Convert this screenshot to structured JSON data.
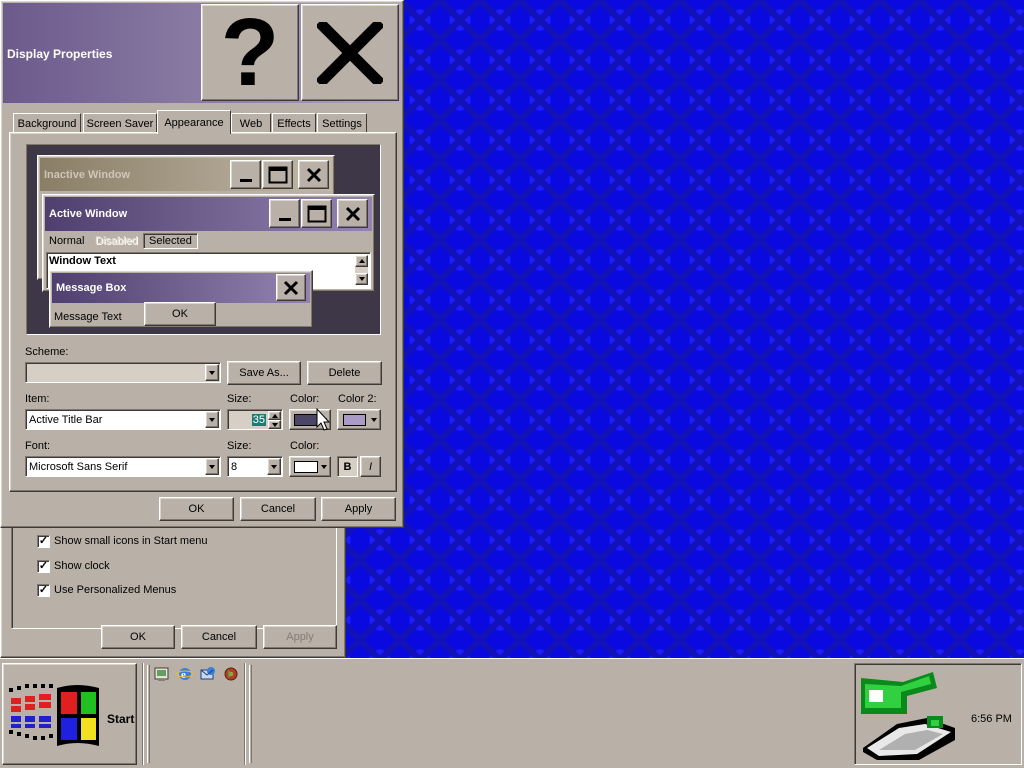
{
  "window": {
    "title": "Display Properties"
  },
  "title_buttons": {
    "help": "?",
    "close": "✕"
  },
  "tabs": [
    {
      "label": "Background"
    },
    {
      "label": "Screen Saver"
    },
    {
      "label": "Appearance"
    },
    {
      "label": "Web"
    },
    {
      "label": "Effects"
    },
    {
      "label": "Settings"
    }
  ],
  "preview": {
    "inactive_title": "Inactive Window",
    "active_title": "Active Window",
    "menu": [
      "Normal",
      "Disabled",
      "Selected"
    ],
    "window_text": "Window Text",
    "message_box_title": "Message Box",
    "message_text": "Message Text",
    "ok": "OK"
  },
  "scheme": {
    "label": "Scheme:",
    "value": "",
    "save_as": "Save As...",
    "delete": "Delete"
  },
  "item": {
    "label": "Item:",
    "value": "Active Title Bar"
  },
  "size1": {
    "label": "Size:",
    "value": "35"
  },
  "color1": {
    "label": "Color:",
    "swatch": "#4d4566"
  },
  "color2": {
    "label": "Color 2:",
    "swatch": "#a99ac6"
  },
  "font": {
    "label": "Font:",
    "value": "Microsoft Sans Serif"
  },
  "size2": {
    "label": "Size:",
    "value": "8"
  },
  "color3": {
    "label": "Color:",
    "swatch": "#ffffff"
  },
  "style_buttons": {
    "bold": "B",
    "italic": "I"
  },
  "footer": {
    "ok": "OK",
    "cancel": "Cancel",
    "apply": "Apply"
  },
  "back_dialog": {
    "options": [
      {
        "label": "Show small icons in Start menu",
        "checked": true
      },
      {
        "label": "Show clock",
        "checked": true
      },
      {
        "label": "Use Personalized Menus",
        "checked": true
      }
    ],
    "ok": "OK",
    "cancel": "Cancel",
    "apply": "Apply"
  },
  "taskbar": {
    "start": "Start",
    "clock": "6:56 PM"
  },
  "colors": {
    "desktop": "#0a0ae0",
    "face": "#b9b1a8",
    "title_active_start": "#6c5a8c",
    "title_active_end": "#b4a7c2"
  }
}
